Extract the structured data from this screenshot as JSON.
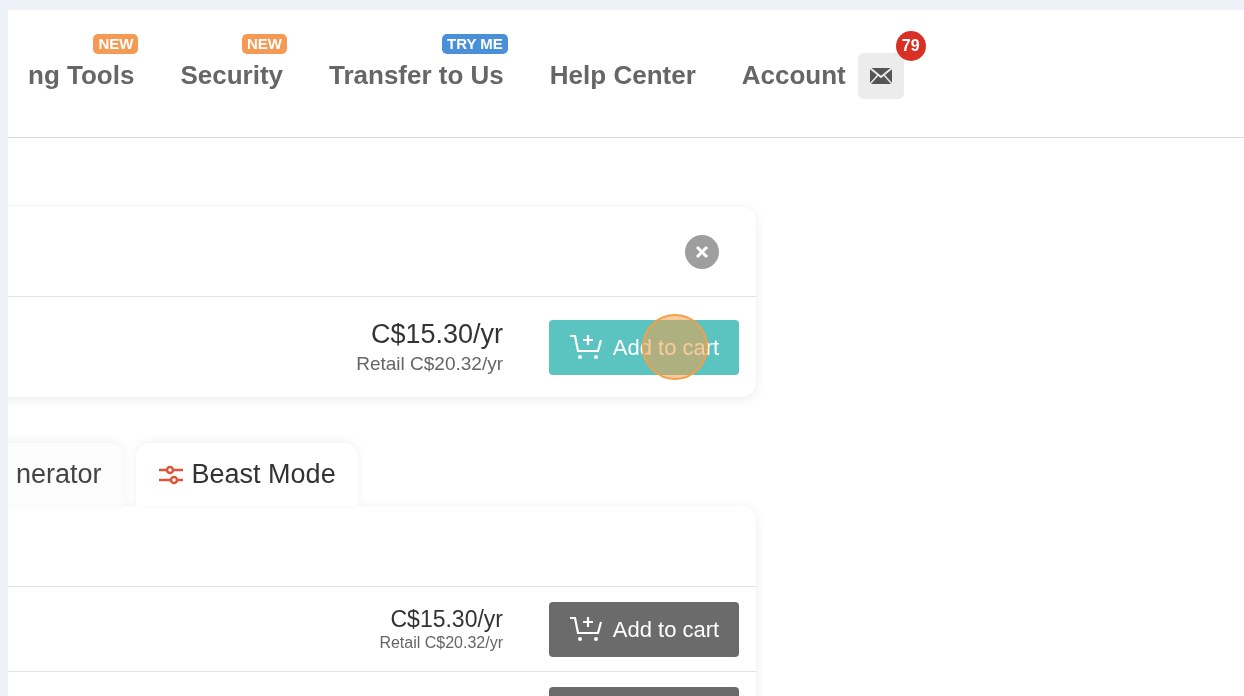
{
  "nav": {
    "items": [
      {
        "label": "ng Tools",
        "badge": {
          "text": "NEW",
          "kind": "new"
        }
      },
      {
        "label": "Security",
        "badge": {
          "text": "NEW",
          "kind": "new"
        }
      },
      {
        "label": "Transfer to Us",
        "badge": {
          "text": "TRY ME",
          "kind": "try"
        }
      },
      {
        "label": "Help Center"
      },
      {
        "label": "Account"
      }
    ],
    "messages": {
      "count": "79"
    }
  },
  "offer_card": {
    "price": "C$15.30/yr",
    "retail": "Retail C$20.32/yr",
    "button": {
      "label": "Add to cart",
      "kind": "primary"
    },
    "click_highlight": true
  },
  "tabs": [
    {
      "label": "nerator",
      "selected": false
    },
    {
      "label": "Beast Mode",
      "selected": true
    }
  ],
  "results": [
    {
      "price": "C$15.30/yr",
      "retail": "Retail C$20.32/yr",
      "button": {
        "label": "Add to cart",
        "kind": "secondary"
      }
    }
  ]
}
